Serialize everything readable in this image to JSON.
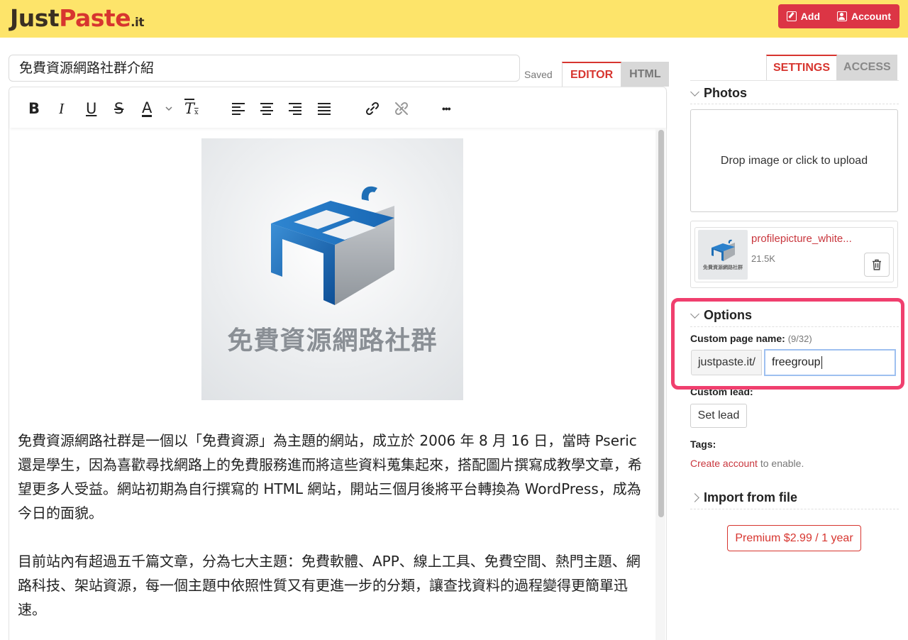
{
  "header": {
    "logo_part1": "Just",
    "logo_part2": "Paste",
    "logo_part3": ".it",
    "add_label": "Add",
    "account_label": "Account"
  },
  "editor_header": {
    "title_value": "免費資源網路社群介紹",
    "saved_text": "Saved",
    "tab_editor": "EDITOR",
    "tab_html": "HTML"
  },
  "toolbar": {
    "bold": "B",
    "italic": "I",
    "underline": "U",
    "strike": "S",
    "font_color": "A",
    "clear_format": "T",
    "more": "•••"
  },
  "content": {
    "image_caption": "免費資源網路社群",
    "paragraph1": "免費資源網路社群是一個以「免費資源」為主題的網站，成立於 2006 年 8 月 16 日，當時 Pseric 還是學生，因為喜歡尋找網路上的免費服務進而將這些資料蒐集起來，搭配圖片撰寫成教學文章，希望更多人受益。網站初期為自行撰寫的 HTML 網站，開站三個月後將平台轉換為 WordPress，成為今日的面貌。",
    "paragraph2": "目前站內有超過五千篇文章，分為七大主題：免費軟體、APP、線上工具、免費空間、熱門主題、網路科技、架站資源，每一個主題中依照性質又有更進一步的分類，讓查找資料的過程變得更簡單迅速。"
  },
  "sidebar": {
    "tab_settings": "SETTINGS",
    "tab_access": "ACCESS",
    "photos_heading": "Photos",
    "dropzone_text": "Drop image or click to upload",
    "file_name": "profilepicture_white...",
    "file_size": "21.5K",
    "thumb_caption": "免費資源網路社群",
    "options_heading": "Options",
    "custom_page_label": "Custom page name:",
    "custom_page_count": "(9/32)",
    "url_prefix": "justpaste.it/",
    "custom_page_value": "freegroup",
    "custom_lead_label": "Custom lead:",
    "set_lead_button": "Set lead",
    "tags_label": "Tags:",
    "create_account_link": "Create account",
    "tags_note_suffix": " to enable.",
    "import_heading": "Import from file",
    "premium_button": "Premium $2.99 / 1 year"
  },
  "colors": {
    "header_bg": "#fde46a",
    "brand_red": "#d7352f",
    "highlight_pink": "#f03f6e",
    "logo_blue": "#1f6fb6"
  }
}
